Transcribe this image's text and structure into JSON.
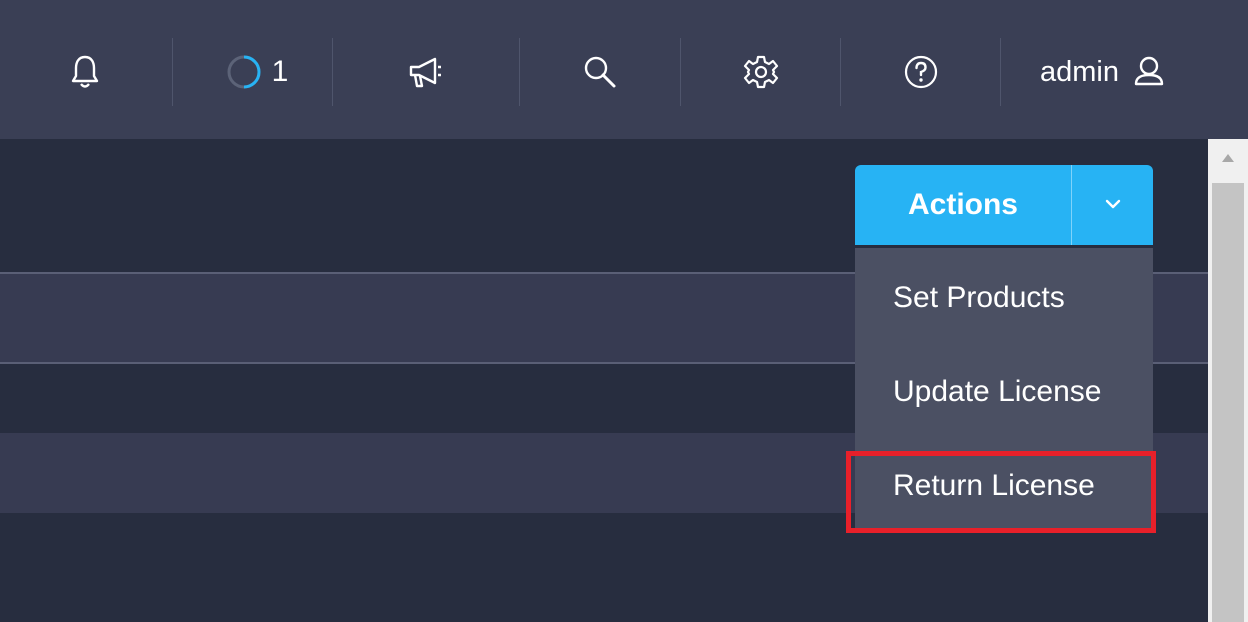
{
  "header": {
    "tasks_count": "1",
    "user_name": "admin",
    "icons": [
      "bell-icon",
      "task-spinner-icon",
      "megaphone-icon",
      "search-icon",
      "gear-icon",
      "help-icon",
      "user-icon"
    ]
  },
  "actions": {
    "label": "Actions",
    "menu": [
      {
        "label": "Set Products"
      },
      {
        "label": "Update License"
      },
      {
        "label": "Return License"
      }
    ]
  },
  "colors": {
    "header_bg": "#3a3f55",
    "content_bg": "#272d3f",
    "accent": "#27b3f4",
    "dropdown_bg": "#4b5063",
    "highlight": "#e8202a"
  }
}
